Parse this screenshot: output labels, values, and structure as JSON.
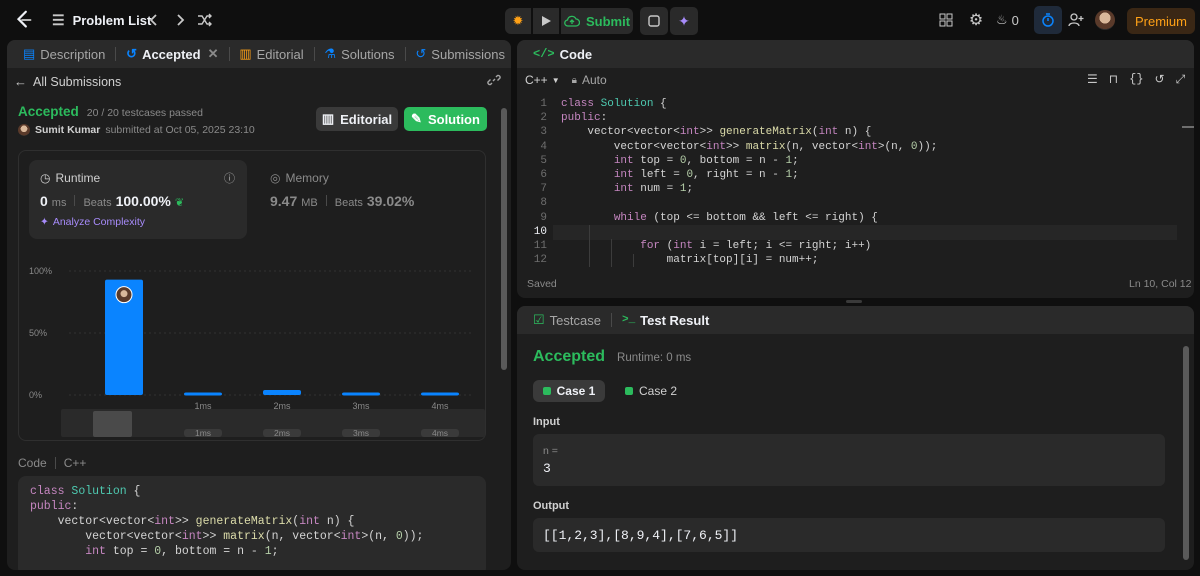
{
  "topbar": {
    "problem_list": "Problem List",
    "submit": "Submit",
    "streak_count": "0",
    "premium": "Premium"
  },
  "left": {
    "tabs": [
      {
        "label": "Description"
      },
      {
        "label": "Accepted"
      },
      {
        "label": "Editorial"
      },
      {
        "label": "Solutions"
      },
      {
        "label": "Submissions"
      }
    ],
    "all_submissions": "All Submissions",
    "status": "Accepted",
    "testcases": "20 / 20 testcases passed",
    "user": "Sumit Kumar",
    "submitted_at": "submitted at Oct 05, 2025 23:10",
    "editorial_btn": "Editorial",
    "solution_btn": "Solution",
    "runtime": {
      "label": "Runtime",
      "value": "0",
      "unit": "ms",
      "beats_label": "Beats",
      "beats_value": "100.00%",
      "analyze": "Analyze Complexity"
    },
    "memory": {
      "label": "Memory",
      "value": "9.47",
      "unit": "MB",
      "beats_label": "Beats",
      "beats_value": "39.02%"
    },
    "code_label": "Code",
    "lang_label": "C++",
    "code_lines": [
      "class Solution {",
      "public:",
      "    vector<vector<int>> generateMatrix(int n) {",
      "        vector<vector<int>> matrix(n, vector<int>(n, 0));",
      "        int top = 0, bottom = n - 1;"
    ]
  },
  "chart_data": {
    "type": "bar",
    "categories": [
      "0ms",
      "1ms",
      "2ms",
      "3ms",
      "4ms"
    ],
    "x_tick_labels": [
      "",
      "1ms",
      "2ms",
      "3ms",
      "4ms"
    ],
    "values": [
      93,
      2,
      4,
      2,
      2
    ],
    "y_ticks": [
      "100%",
      "50%",
      "0%"
    ],
    "ylim": [
      0,
      100
    ],
    "minimap_labels": [
      "1ms",
      "2ms",
      "3ms",
      "4ms"
    ],
    "bar_color": "#0a84ff"
  },
  "editor": {
    "title": "Code",
    "lang": "C++",
    "mode": "Auto",
    "saved": "Saved",
    "cursor": "Ln 10, Col 12",
    "line_numbers": [
      "1",
      "2",
      "3",
      "4",
      "5",
      "6",
      "7",
      "8",
      "9",
      "10",
      "11",
      "12"
    ],
    "lines": [
      "class Solution {",
      "public:",
      "    vector<vector<int>> generateMatrix(int n) {",
      "        vector<vector<int>> matrix(n, vector<int>(n, 0));",
      "        int top = 0, bottom = n - 1;",
      "        int left = 0, right = n - 1;",
      "        int num = 1;",
      "",
      "        while (top <= bottom && left <= right) {",
      "",
      "            for (int i = left; i <= right; i++)",
      "                matrix[top][i] = num++;"
    ]
  },
  "result": {
    "tab_testcase": "Testcase",
    "tab_result": "Test Result",
    "status": "Accepted",
    "runtime": "Runtime: 0 ms",
    "case1": "Case 1",
    "case2": "Case 2",
    "input_label": "Input",
    "input_var": "n =",
    "input_value": "3",
    "output_label": "Output",
    "output_value": "[[1,2,3],[8,9,4],[7,6,5]]"
  }
}
